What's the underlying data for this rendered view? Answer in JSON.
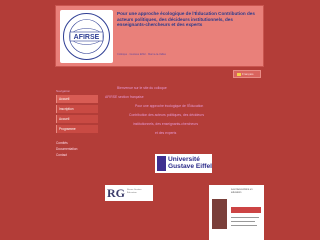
{
  "header": {
    "logo_text": "AFIRSE",
    "title": "Pour une approche écologique de l'Éducation Contribution des acteurs politiques, des décideurs institutionnels, des enseignants-chercheurs et des experts",
    "subtitle": "Colloque · Gustave Eiffel · Marne-la-Vallée"
  },
  "lang": {
    "label": "Français"
  },
  "sidebar": {
    "heading": "Navigation",
    "items": [
      {
        "label": "Accueil"
      },
      {
        "label": "Inscription"
      },
      {
        "label": "Accueil"
      },
      {
        "label": "Programme"
      }
    ],
    "links": [
      {
        "label": "Comités"
      },
      {
        "label": "Documentation"
      },
      {
        "label": "Contact"
      }
    ]
  },
  "main": {
    "lines": [
      "Bienvenue sur le site du colloque",
      "AFIRSE section française",
      "Pour une approche écologique de l'Éducation",
      "Contribution des acteurs politiques, des décideurs",
      "institutionnels, des enseignants-chercheurs",
      "et des experts"
    ]
  },
  "partners": {
    "uge": "Université Gustave Eiffel",
    "rg": {
      "mark": "RG",
      "text": "Revue Gestion Éducation"
    },
    "book": {
      "title": "Les interventions en éducation"
    }
  }
}
